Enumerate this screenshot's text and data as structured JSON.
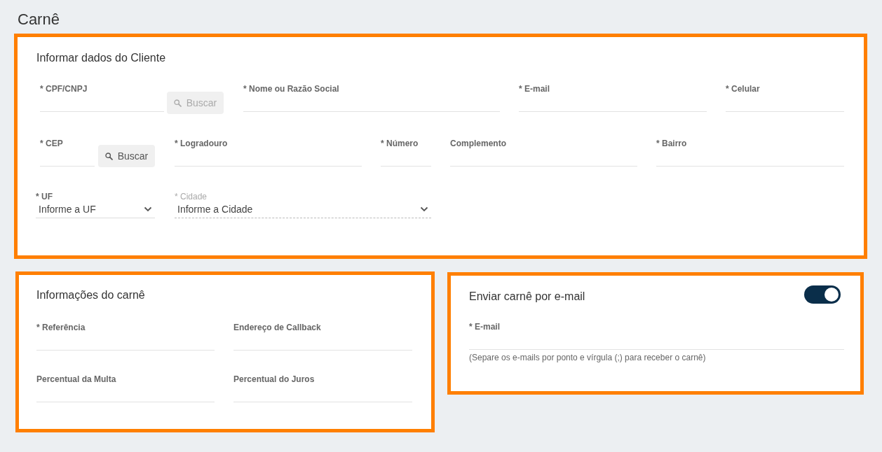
{
  "page_title": "Carnê",
  "client_section": {
    "title": "Informar dados do Cliente",
    "fields": [
      {
        "kind": "text",
        "label": "* CPF/CNPJ",
        "search_button": {
          "label": "Buscar",
          "disabled": true
        }
      },
      {
        "kind": "text",
        "label": "* Nome ou Razão Social"
      },
      {
        "kind": "text",
        "label": "* E-mail"
      },
      {
        "kind": "text",
        "label": "* Celular"
      },
      {
        "kind": "text",
        "label": "* CEP",
        "search_button": {
          "label": "Buscar",
          "disabled": false
        }
      },
      {
        "kind": "text",
        "label": "* Logradouro"
      },
      {
        "kind": "text",
        "label": "* Número"
      },
      {
        "kind": "text",
        "label": "Complemento"
      },
      {
        "kind": "text",
        "label": "* Bairro"
      },
      {
        "kind": "select",
        "label": "* UF",
        "value": "Informe a UF",
        "disabled": false
      },
      {
        "kind": "select",
        "label": "* Cidade",
        "value": "Informe a Cidade",
        "disabled": true
      }
    ]
  },
  "carne_section": {
    "title": "Informações do carnê",
    "fields": [
      {
        "label": "* Referência"
      },
      {
        "label": "Endereço de Callback"
      },
      {
        "label": "Percentual da Multa"
      },
      {
        "label": "Percentual do Juros"
      }
    ]
  },
  "email_section": {
    "title": "Enviar carnê por e-mail",
    "on": true,
    "field": {
      "label": "* E-mail"
    },
    "hint": "(Separe os e-mails por ponto e vírgula (;) para receber o carnê)"
  }
}
